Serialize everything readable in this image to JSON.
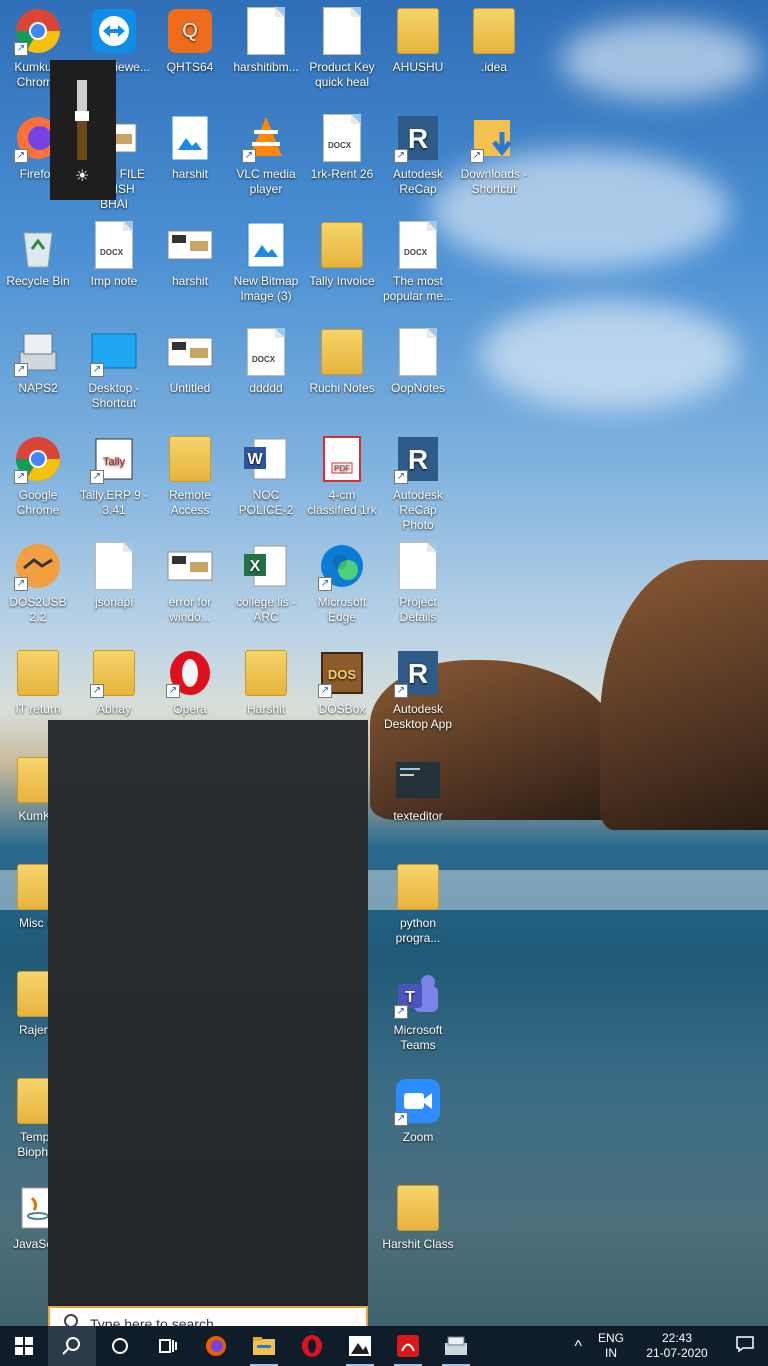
{
  "desktop": {
    "icons": [
      {
        "label": "Kumkum Chrome",
        "icon": "chrome-profile-icon",
        "shortcut": true
      },
      {
        "label": "TeamViewe...",
        "icon": "teamviewer-icon",
        "shortcut": false
      },
      {
        "label": "QHTS64",
        "icon": "quickheal-icon",
        "shortcut": false
      },
      {
        "label": "harshitibm...",
        "icon": "document-icon",
        "shortcut": false
      },
      {
        "label": "Product Key quick heal",
        "icon": "document-icon",
        "shortcut": false
      },
      {
        "label": "AHUSHU",
        "icon": "folder-docx-icon",
        "shortcut": false
      },
      {
        "label": ".idea",
        "icon": "folder-icon",
        "shortcut": false
      },
      {
        "label": "Firefox",
        "icon": "firefox-icon",
        "shortcut": true
      },
      {
        "label": "CASH FILE GIRISH BHAI",
        "icon": "image-file-icon",
        "shortcut": false
      },
      {
        "label": "harshit",
        "icon": "bitmap-icon",
        "shortcut": false
      },
      {
        "label": "VLC media player",
        "icon": "vlc-icon",
        "shortcut": true
      },
      {
        "label": "1rk-Rent 26",
        "icon": "docx-icon",
        "shortcut": false
      },
      {
        "label": "Autodesk ReCap",
        "icon": "recap-icon",
        "shortcut": true
      },
      {
        "label": "Downloads - Shortcut",
        "icon": "downloads-folder-icon",
        "shortcut": true
      },
      {
        "label": "Recycle Bin",
        "icon": "recycle-bin-icon",
        "shortcut": false
      },
      {
        "label": "Imp note",
        "icon": "docx-icon",
        "shortcut": false
      },
      {
        "label": "harshit",
        "icon": "image-thumbnail-icon",
        "shortcut": false
      },
      {
        "label": "New Bitmap Image (3)",
        "icon": "bitmap-icon",
        "shortcut": false
      },
      {
        "label": "Tally Invoice",
        "icon": "folder-word-icon",
        "shortcut": false
      },
      {
        "label": "The most popular me...",
        "icon": "docx-icon",
        "shortcut": false
      },
      {
        "label": "NAPS2",
        "icon": "scanner-icon",
        "shortcut": true
      },
      {
        "label": "Desktop - Shortcut",
        "icon": "desktop-icon",
        "shortcut": true
      },
      {
        "label": "Untitled",
        "icon": "image-thumbnail-icon",
        "shortcut": false
      },
      {
        "label": "ddddd",
        "icon": "docx-icon",
        "shortcut": false
      },
      {
        "label": "Ruchi Notes",
        "icon": "folder-icon",
        "shortcut": false
      },
      {
        "label": "OopNotes",
        "icon": "document-icon",
        "shortcut": false
      },
      {
        "label": "Google Chrome",
        "icon": "chrome-icon",
        "shortcut": true
      },
      {
        "label": "Tally.ERP 9 - 3.41",
        "icon": "tally-icon",
        "shortcut": true
      },
      {
        "label": "Remote Access",
        "icon": "folder-teamviewer-icon",
        "shortcut": false
      },
      {
        "label": "NOC POLICE-2",
        "icon": "word-icon",
        "shortcut": false
      },
      {
        "label": "4-cm classified 1rk",
        "icon": "pdf-icon",
        "shortcut": false
      },
      {
        "label": "Autodesk ReCap Photo",
        "icon": "recap-photo-icon",
        "shortcut": true
      },
      {
        "label": "DOS2USB 2.2",
        "icon": "handshake-icon",
        "shortcut": true
      },
      {
        "label": "jsonapi",
        "icon": "document-icon",
        "shortcut": false
      },
      {
        "label": "error for windo...",
        "icon": "image-thumbnail-icon",
        "shortcut": false
      },
      {
        "label": "college lis -ARC",
        "icon": "excel-icon",
        "shortcut": false
      },
      {
        "label": "Microsoft Edge",
        "icon": "edge-icon",
        "shortcut": true
      },
      {
        "label": "Project Details",
        "icon": "document-icon",
        "shortcut": false
      },
      {
        "label": "IT return",
        "icon": "folder-pdf-icon",
        "shortcut": false
      },
      {
        "label": "Abhay",
        "icon": "folder-docx-icon",
        "shortcut": true
      },
      {
        "label": "Opera",
        "icon": "opera-icon",
        "shortcut": true
      },
      {
        "label": "Harshit",
        "icon": "folder-icon",
        "shortcut": false
      },
      {
        "label": "DOSBox",
        "icon": "dosbox-icon",
        "shortcut": true
      },
      {
        "label": "Autodesk Desktop App",
        "icon": "autodesk-icon",
        "shortcut": true
      },
      {
        "label": "KumKu",
        "icon": "folder-excel-icon",
        "shortcut": false
      },
      {
        "label": "texteditor",
        "icon": "terminal-icon",
        "shortcut": false
      },
      {
        "label": "Misc In",
        "icon": "folder-pdf-icon",
        "shortcut": false
      },
      {
        "label": "python progra...",
        "icon": "folder-icon",
        "shortcut": false
      },
      {
        "label": "Rajend",
        "icon": "folder-chrome-icon",
        "shortcut": false
      },
      {
        "label": "Microsoft Teams",
        "icon": "teams-icon",
        "shortcut": true
      },
      {
        "label": "Temp f Biophar",
        "icon": "folder-pdf-icon",
        "shortcut": false
      },
      {
        "label": "Zoom",
        "icon": "zoom-icon",
        "shortcut": true
      },
      {
        "label": "JavaSetu",
        "icon": "java-icon",
        "shortcut": false
      },
      {
        "label": "Harshit Class",
        "icon": "folder-icon",
        "shortcut": false
      }
    ]
  },
  "brightness": {
    "level": 0.55,
    "icon": "brightness-icon"
  },
  "search": {
    "placeholder": "Type here to search"
  },
  "taskbar": {
    "apps": [
      {
        "name": "start-button",
        "icon": "windows-icon"
      },
      {
        "name": "search-button",
        "icon": "search-icon"
      },
      {
        "name": "cortana-button",
        "icon": "cortana-icon"
      },
      {
        "name": "task-view-button",
        "icon": "task-view-icon"
      },
      {
        "name": "firefox-taskbar",
        "icon": "firefox-icon"
      },
      {
        "name": "file-explorer-taskbar",
        "icon": "folder-icon"
      },
      {
        "name": "opera-taskbar",
        "icon": "opera-icon"
      },
      {
        "name": "photos-taskbar",
        "icon": "photos-icon"
      },
      {
        "name": "acrobat-taskbar",
        "icon": "acrobat-icon"
      },
      {
        "name": "naps2-taskbar",
        "icon": "scanner-icon"
      }
    ],
    "tray": {
      "chevron": "^",
      "lang_top": "ENG",
      "lang_bottom": "IN",
      "time": "22:43",
      "date": "21-07-2020"
    }
  }
}
